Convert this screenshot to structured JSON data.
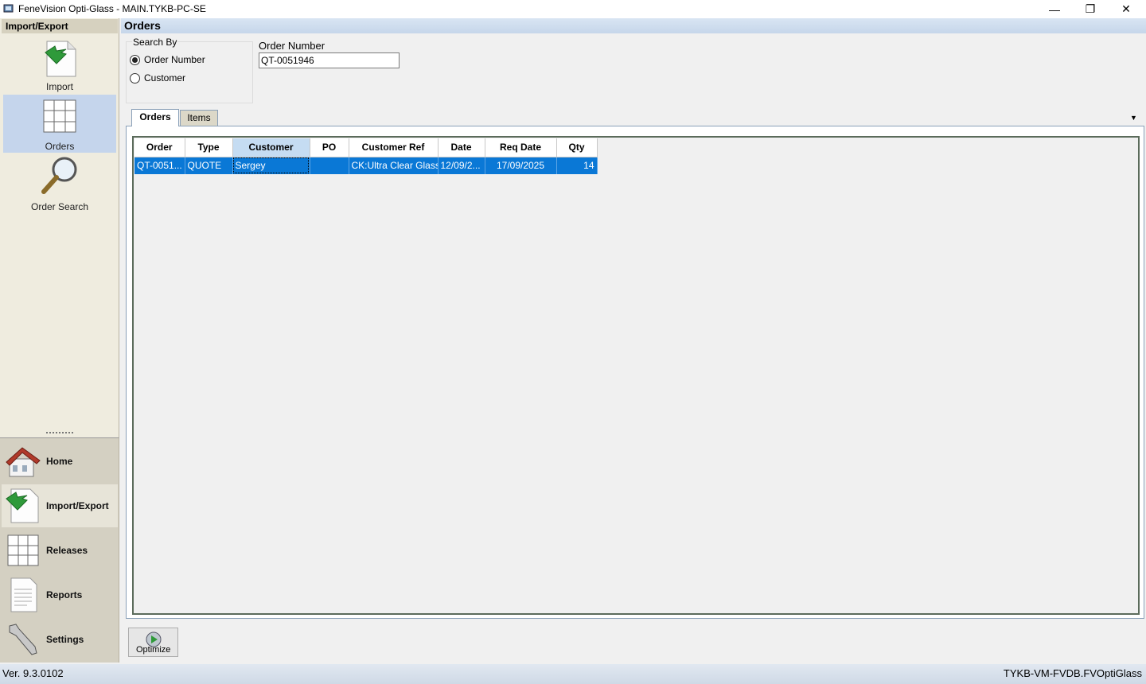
{
  "window": {
    "title": "FeneVision Opti-Glass - MAIN.TYKB-PC-SE",
    "minimize": "—",
    "restore": "❐",
    "close": "✕"
  },
  "nav": {
    "header": "Import/Export",
    "items": [
      {
        "label": "Import",
        "icon": "import-icon"
      },
      {
        "label": "Orders",
        "icon": "grid-icon"
      },
      {
        "label": "Order Search",
        "icon": "magnifier-icon"
      }
    ],
    "sections": [
      {
        "label": "Home",
        "icon": "house-icon"
      },
      {
        "label": "Import/Export",
        "icon": "import-icon"
      },
      {
        "label": "Releases",
        "icon": "grid-icon"
      },
      {
        "label": "Reports",
        "icon": "document-icon"
      },
      {
        "label": "Settings",
        "icon": "wrench-icon"
      }
    ]
  },
  "main": {
    "title": "Orders",
    "search_by": {
      "legend": "Search By",
      "options": [
        "Order Number",
        "Customer"
      ],
      "selected": "Order Number"
    },
    "order_number": {
      "label": "Order Number",
      "value": "QT-0051946"
    },
    "tabs": [
      "Orders",
      "Items"
    ],
    "chevron": "▼",
    "grid": {
      "columns": [
        "Order",
        "Type",
        "Customer",
        "PO",
        "Customer Ref",
        "Date",
        "Req Date",
        "Qty"
      ],
      "rows": [
        [
          "QT-0051...",
          "QUOTE",
          "Sergey",
          "",
          "CK:Ultra Clear Glass...",
          "12/09/2...",
          "17/09/2025",
          "14"
        ]
      ]
    },
    "optimize_label": "Optimize"
  },
  "status": {
    "version": "Ver. 9.3.0102",
    "database": "TYKB-VM-FVDB.FVOptiGlass"
  },
  "colors": {
    "selection": "#0a78d6",
    "header_blue": "#c6d6ea",
    "nav_bg": "#efecdf"
  }
}
